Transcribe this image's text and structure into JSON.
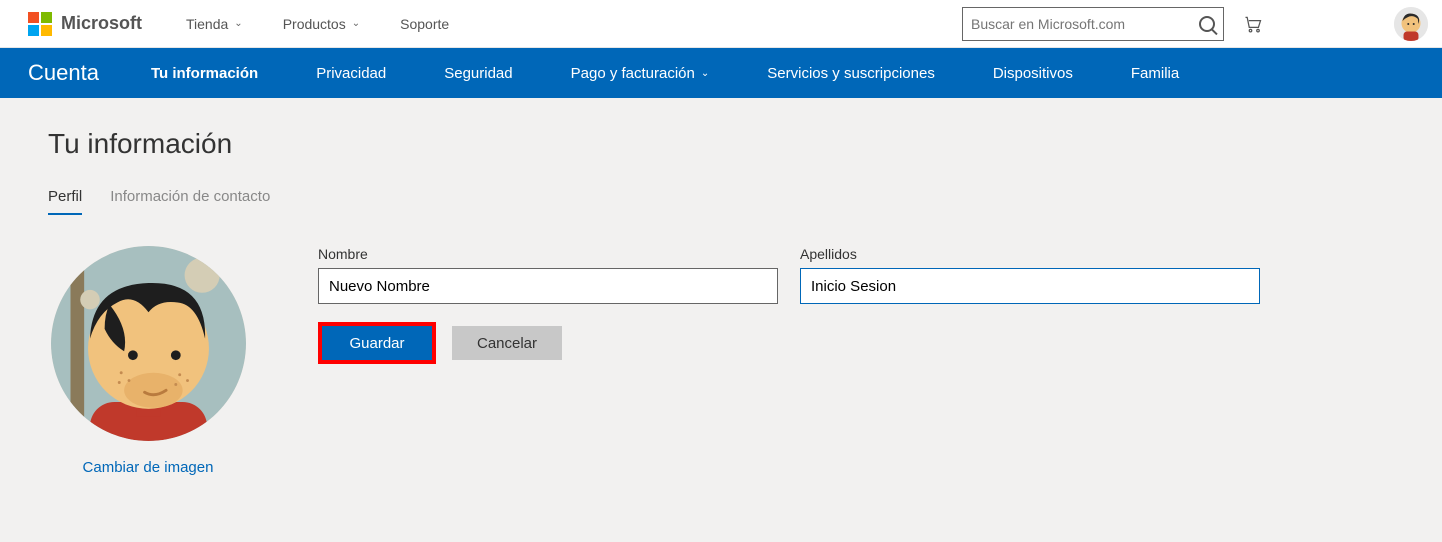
{
  "top": {
    "brand": "Microsoft",
    "nav": {
      "tienda": "Tienda",
      "productos": "Productos",
      "soporte": "Soporte"
    },
    "search_placeholder": "Buscar en Microsoft.com"
  },
  "subnav": {
    "title": "Cuenta",
    "items": {
      "tu_info": "Tu información",
      "privacidad": "Privacidad",
      "seguridad": "Seguridad",
      "pago": "Pago y facturación",
      "servicios": "Servicios y suscripciones",
      "dispositivos": "Dispositivos",
      "familia": "Familia"
    }
  },
  "page": {
    "title": "Tu información",
    "tabs": {
      "perfil": "Perfil",
      "contacto": "Información de contacto"
    },
    "change_image": "Cambiar de imagen",
    "form": {
      "nombre_label": "Nombre",
      "nombre_value": "Nuevo Nombre",
      "apellidos_label": "Apellidos",
      "apellidos_value": "Inicio Sesion",
      "save": "Guardar",
      "cancel": "Cancelar"
    }
  }
}
